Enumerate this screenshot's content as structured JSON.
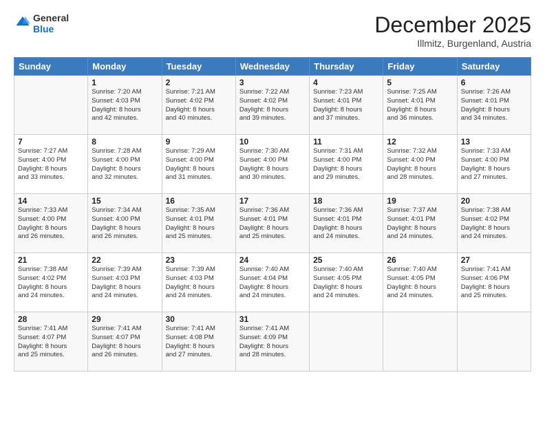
{
  "header": {
    "logo_line1": "General",
    "logo_line2": "Blue",
    "month": "December 2025",
    "location": "Illmitz, Burgenland, Austria"
  },
  "weekdays": [
    "Sunday",
    "Monday",
    "Tuesday",
    "Wednesday",
    "Thursday",
    "Friday",
    "Saturday"
  ],
  "weeks": [
    [
      {
        "day": "",
        "info": ""
      },
      {
        "day": "1",
        "info": "Sunrise: 7:20 AM\nSunset: 4:03 PM\nDaylight: 8 hours\nand 42 minutes."
      },
      {
        "day": "2",
        "info": "Sunrise: 7:21 AM\nSunset: 4:02 PM\nDaylight: 8 hours\nand 40 minutes."
      },
      {
        "day": "3",
        "info": "Sunrise: 7:22 AM\nSunset: 4:02 PM\nDaylight: 8 hours\nand 39 minutes."
      },
      {
        "day": "4",
        "info": "Sunrise: 7:23 AM\nSunset: 4:01 PM\nDaylight: 8 hours\nand 37 minutes."
      },
      {
        "day": "5",
        "info": "Sunrise: 7:25 AM\nSunset: 4:01 PM\nDaylight: 8 hours\nand 36 minutes."
      },
      {
        "day": "6",
        "info": "Sunrise: 7:26 AM\nSunset: 4:01 PM\nDaylight: 8 hours\nand 34 minutes."
      }
    ],
    [
      {
        "day": "7",
        "info": "Sunrise: 7:27 AM\nSunset: 4:00 PM\nDaylight: 8 hours\nand 33 minutes."
      },
      {
        "day": "8",
        "info": "Sunrise: 7:28 AM\nSunset: 4:00 PM\nDaylight: 8 hours\nand 32 minutes."
      },
      {
        "day": "9",
        "info": "Sunrise: 7:29 AM\nSunset: 4:00 PM\nDaylight: 8 hours\nand 31 minutes."
      },
      {
        "day": "10",
        "info": "Sunrise: 7:30 AM\nSunset: 4:00 PM\nDaylight: 8 hours\nand 30 minutes."
      },
      {
        "day": "11",
        "info": "Sunrise: 7:31 AM\nSunset: 4:00 PM\nDaylight: 8 hours\nand 29 minutes."
      },
      {
        "day": "12",
        "info": "Sunrise: 7:32 AM\nSunset: 4:00 PM\nDaylight: 8 hours\nand 28 minutes."
      },
      {
        "day": "13",
        "info": "Sunrise: 7:33 AM\nSunset: 4:00 PM\nDaylight: 8 hours\nand 27 minutes."
      }
    ],
    [
      {
        "day": "14",
        "info": "Sunrise: 7:33 AM\nSunset: 4:00 PM\nDaylight: 8 hours\nand 26 minutes."
      },
      {
        "day": "15",
        "info": "Sunrise: 7:34 AM\nSunset: 4:00 PM\nDaylight: 8 hours\nand 26 minutes."
      },
      {
        "day": "16",
        "info": "Sunrise: 7:35 AM\nSunset: 4:01 PM\nDaylight: 8 hours\nand 25 minutes."
      },
      {
        "day": "17",
        "info": "Sunrise: 7:36 AM\nSunset: 4:01 PM\nDaylight: 8 hours\nand 25 minutes."
      },
      {
        "day": "18",
        "info": "Sunrise: 7:36 AM\nSunset: 4:01 PM\nDaylight: 8 hours\nand 24 minutes."
      },
      {
        "day": "19",
        "info": "Sunrise: 7:37 AM\nSunset: 4:01 PM\nDaylight: 8 hours\nand 24 minutes."
      },
      {
        "day": "20",
        "info": "Sunrise: 7:38 AM\nSunset: 4:02 PM\nDaylight: 8 hours\nand 24 minutes."
      }
    ],
    [
      {
        "day": "21",
        "info": "Sunrise: 7:38 AM\nSunset: 4:02 PM\nDaylight: 8 hours\nand 24 minutes."
      },
      {
        "day": "22",
        "info": "Sunrise: 7:39 AM\nSunset: 4:03 PM\nDaylight: 8 hours\nand 24 minutes."
      },
      {
        "day": "23",
        "info": "Sunrise: 7:39 AM\nSunset: 4:03 PM\nDaylight: 8 hours\nand 24 minutes."
      },
      {
        "day": "24",
        "info": "Sunrise: 7:40 AM\nSunset: 4:04 PM\nDaylight: 8 hours\nand 24 minutes."
      },
      {
        "day": "25",
        "info": "Sunrise: 7:40 AM\nSunset: 4:05 PM\nDaylight: 8 hours\nand 24 minutes."
      },
      {
        "day": "26",
        "info": "Sunrise: 7:40 AM\nSunset: 4:05 PM\nDaylight: 8 hours\nand 24 minutes."
      },
      {
        "day": "27",
        "info": "Sunrise: 7:41 AM\nSunset: 4:06 PM\nDaylight: 8 hours\nand 25 minutes."
      }
    ],
    [
      {
        "day": "28",
        "info": "Sunrise: 7:41 AM\nSunset: 4:07 PM\nDaylight: 8 hours\nand 25 minutes."
      },
      {
        "day": "29",
        "info": "Sunrise: 7:41 AM\nSunset: 4:07 PM\nDaylight: 8 hours\nand 26 minutes."
      },
      {
        "day": "30",
        "info": "Sunrise: 7:41 AM\nSunset: 4:08 PM\nDaylight: 8 hours\nand 27 minutes."
      },
      {
        "day": "31",
        "info": "Sunrise: 7:41 AM\nSunset: 4:09 PM\nDaylight: 8 hours\nand 28 minutes."
      },
      {
        "day": "",
        "info": ""
      },
      {
        "day": "",
        "info": ""
      },
      {
        "day": "",
        "info": ""
      }
    ]
  ]
}
